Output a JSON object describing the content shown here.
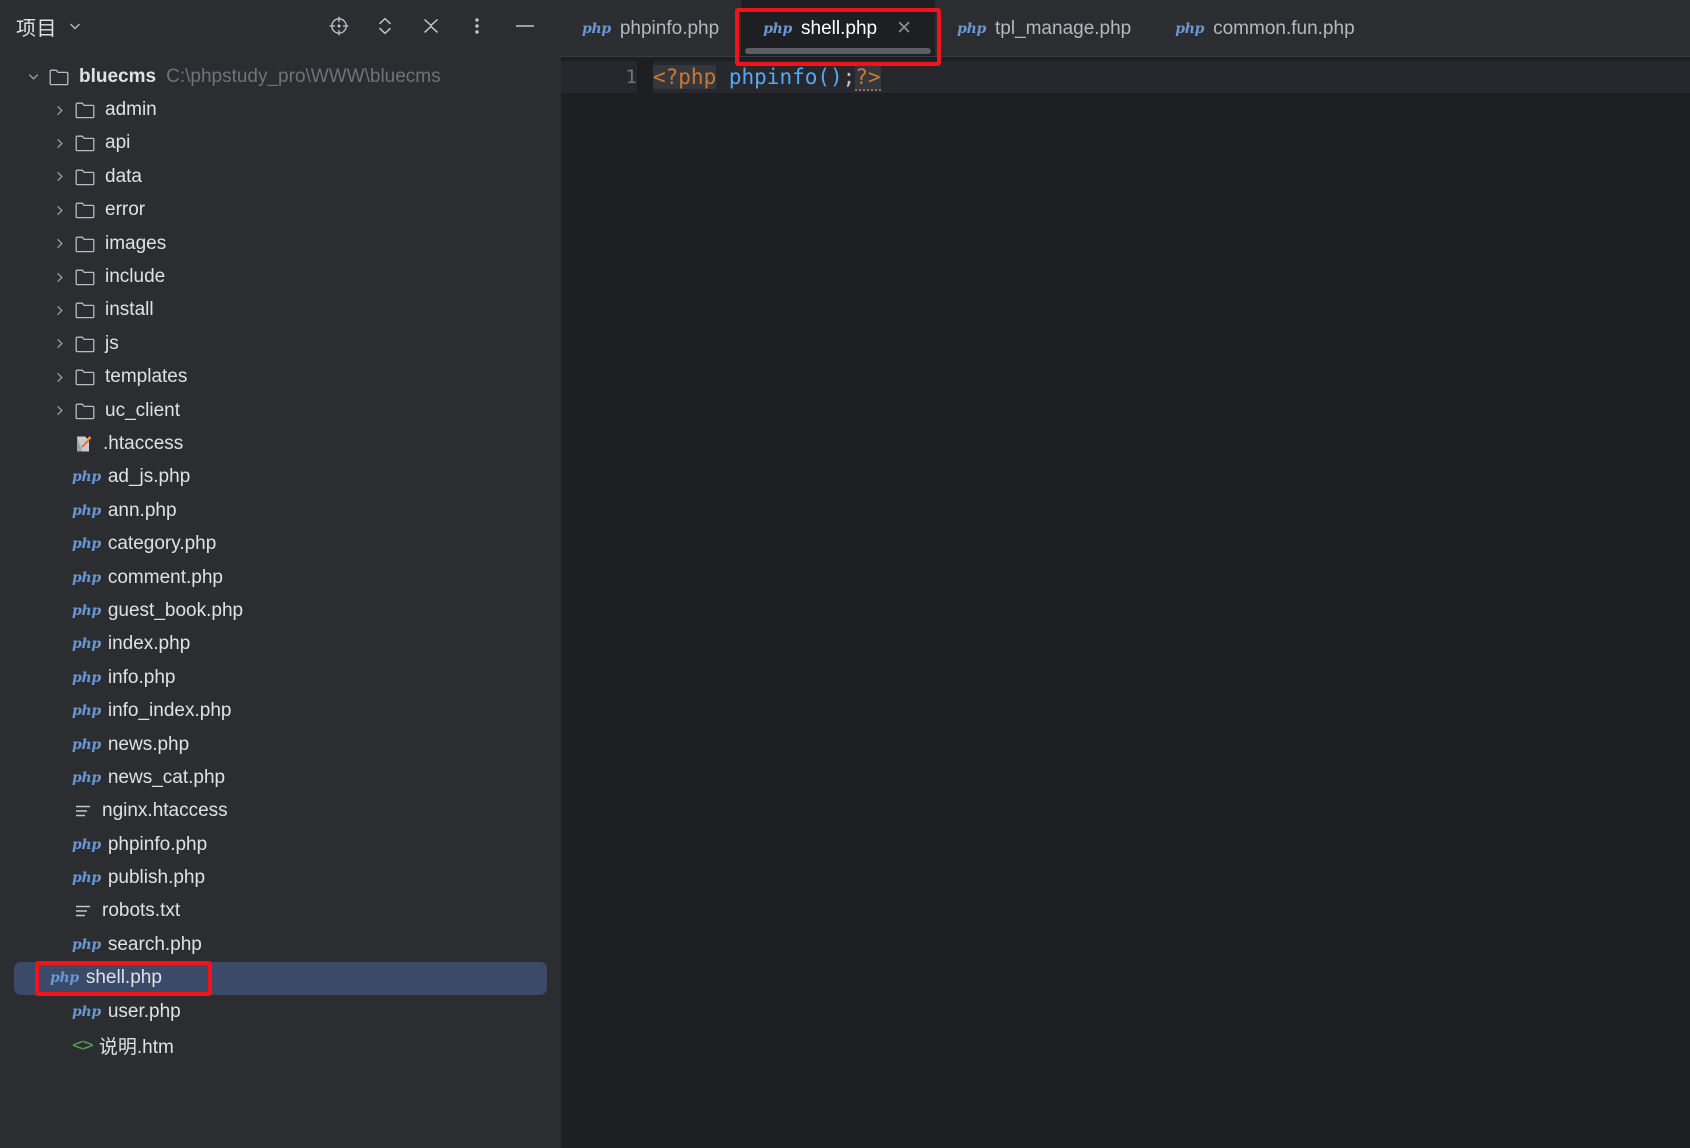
{
  "sidebar": {
    "title": "项目",
    "chevron_icon": "chevron-down-icon",
    "tools": [
      {
        "name": "select-opened-file-icon",
        "label": "Select Opened File"
      },
      {
        "name": "expand-all-icon",
        "label": "Expand All"
      },
      {
        "name": "collapse-all-icon",
        "label": "Collapse All"
      },
      {
        "name": "more-options-icon",
        "label": "Options"
      },
      {
        "name": "minimize-icon",
        "label": "Hide"
      }
    ],
    "root": {
      "name": "bluecms",
      "path": "C:\\phpstudy_pro\\WWW\\bluecms",
      "expanded": true,
      "icon": "folder-icon"
    },
    "tree": [
      {
        "label": "admin",
        "type": "folder",
        "icon": "folder-icon",
        "expanded": false
      },
      {
        "label": "api",
        "type": "folder",
        "icon": "folder-icon",
        "expanded": false
      },
      {
        "label": "data",
        "type": "folder",
        "icon": "folder-icon",
        "expanded": false
      },
      {
        "label": "error",
        "type": "folder",
        "icon": "folder-icon",
        "expanded": false
      },
      {
        "label": "images",
        "type": "folder",
        "icon": "folder-icon",
        "expanded": false
      },
      {
        "label": "include",
        "type": "folder",
        "icon": "folder-icon",
        "expanded": false
      },
      {
        "label": "install",
        "type": "folder",
        "icon": "folder-icon",
        "expanded": false
      },
      {
        "label": "js",
        "type": "folder",
        "icon": "folder-icon",
        "expanded": false
      },
      {
        "label": "templates",
        "type": "folder",
        "icon": "folder-icon",
        "expanded": false
      },
      {
        "label": "uc_client",
        "type": "folder",
        "icon": "folder-icon",
        "expanded": false
      },
      {
        "label": ".htaccess",
        "type": "file",
        "icon": "htaccess-icon"
      },
      {
        "label": "ad_js.php",
        "type": "file",
        "icon": "php-icon"
      },
      {
        "label": "ann.php",
        "type": "file",
        "icon": "php-icon"
      },
      {
        "label": "category.php",
        "type": "file",
        "icon": "php-icon"
      },
      {
        "label": "comment.php",
        "type": "file",
        "icon": "php-icon"
      },
      {
        "label": "guest_book.php",
        "type": "file",
        "icon": "php-icon"
      },
      {
        "label": "index.php",
        "type": "file",
        "icon": "php-icon"
      },
      {
        "label": "info.php",
        "type": "file",
        "icon": "php-icon"
      },
      {
        "label": "info_index.php",
        "type": "file",
        "icon": "php-icon"
      },
      {
        "label": "news.php",
        "type": "file",
        "icon": "php-icon"
      },
      {
        "label": "news_cat.php",
        "type": "file",
        "icon": "php-icon"
      },
      {
        "label": "nginx.htaccess",
        "type": "file",
        "icon": "text-file-icon"
      },
      {
        "label": "phpinfo.php",
        "type": "file",
        "icon": "php-icon"
      },
      {
        "label": "publish.php",
        "type": "file",
        "icon": "php-icon"
      },
      {
        "label": "robots.txt",
        "type": "file",
        "icon": "text-file-icon"
      },
      {
        "label": "search.php",
        "type": "file",
        "icon": "php-icon"
      },
      {
        "label": "shell.php",
        "type": "file",
        "icon": "php-icon",
        "selected": true
      },
      {
        "label": "user.php",
        "type": "file",
        "icon": "php-icon"
      },
      {
        "label": "说明.htm",
        "type": "file",
        "icon": "html-icon"
      }
    ]
  },
  "editor": {
    "tabs": [
      {
        "label": "phpinfo.php",
        "icon": "php-icon",
        "active": false,
        "closable": false
      },
      {
        "label": "shell.php",
        "icon": "php-icon",
        "active": true,
        "closable": true,
        "close_icon": "close-icon"
      },
      {
        "label": "tpl_manage.php",
        "icon": "php-icon",
        "active": false,
        "closable": false
      },
      {
        "label": "common.fun.php",
        "icon": "php-icon",
        "active": false,
        "closable": false
      }
    ],
    "php_badge": "php",
    "gutter": [
      "1"
    ],
    "code_line_1": {
      "open_tag": "<?php",
      "space": " ",
      "fn": "phpinfo()",
      "semicolon": ";",
      "close_tag": "?>"
    }
  },
  "annotations": {
    "tab_highlight": "red-highlight-box-active-tab",
    "tree_highlight": "red-highlight-box-shell-php"
  },
  "colors": {
    "sidebar_bg": "#2b2d30",
    "editor_bg": "#1e1f22",
    "selection_bg": "#3b4a69",
    "annotation_red": "#f4121a",
    "php_badge_blue": "#6897d6",
    "keyword_orange": "#cc7832",
    "function_blue": "#56a8f5",
    "text_primary": "#dfe1e5",
    "text_muted": "#6f737a"
  }
}
